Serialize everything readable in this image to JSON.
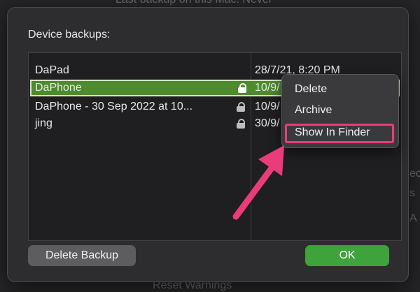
{
  "background": {
    "top_text": "Last backup on this Mac: Never",
    "bottom_text": "Reset Warnings",
    "right_fragments": [
      "ec",
      "s",
      "A"
    ]
  },
  "dialog": {
    "title": "Device backups:",
    "rows": [
      {
        "name": "DaPad",
        "date": "28/7/21, 8:20 PM",
        "locked": false,
        "selected": false
      },
      {
        "name": "DaPhone",
        "date": "10/9/",
        "locked": true,
        "selected": true
      },
      {
        "name": "DaPhone - 30 Sep 2022 at 10...",
        "date": "10/9/",
        "locked": true,
        "selected": false
      },
      {
        "name": "jing",
        "date": "30/9/",
        "locked": true,
        "selected": false
      }
    ],
    "delete_button": "Delete Backup",
    "ok_button": "OK"
  },
  "context_menu": {
    "items": [
      "Delete",
      "Archive",
      "Show In Finder"
    ],
    "highlighted_item": "Show In Finder"
  },
  "annotation": {
    "arrow_color": "#ea3c7a",
    "box_color": "#ea3c7a"
  },
  "colors": {
    "selection": "#4e8a2e",
    "ok_button": "#3ea33a",
    "dialog_bg": "#2d2d2f"
  },
  "icons": {
    "lock": "lock-icon"
  }
}
